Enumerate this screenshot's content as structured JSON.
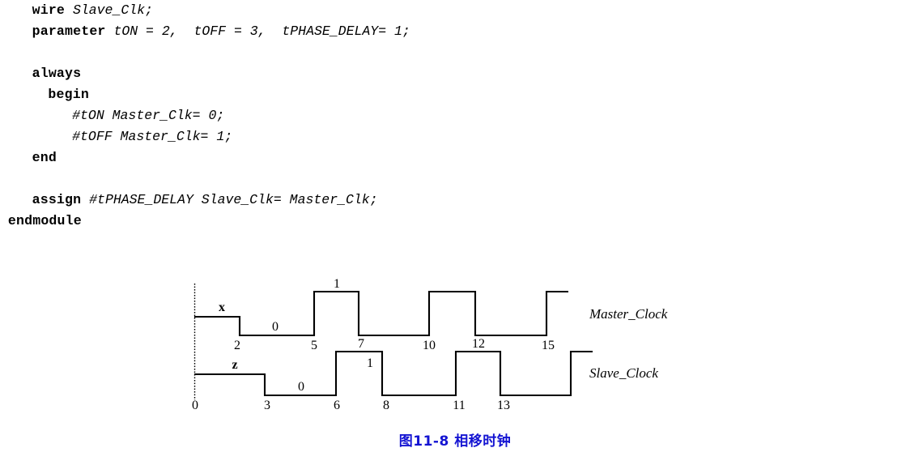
{
  "code": {
    "language": "verilog",
    "lines": [
      {
        "indent": 4,
        "tokens": [
          {
            "text": "wire",
            "style": "keyword"
          },
          {
            "text": " ",
            "style": "plain"
          },
          {
            "text": "Slave_Clk;",
            "style": "identifier"
          }
        ]
      },
      {
        "indent": 4,
        "tokens": [
          {
            "text": "parameter",
            "style": "keyword"
          },
          {
            "text": " ",
            "style": "plain"
          },
          {
            "text": "tON = 2,  tOFF = 3,  tPHASE_DELAY= 1;",
            "style": "identifier"
          }
        ]
      },
      {
        "indent": 0,
        "tokens": []
      },
      {
        "indent": 4,
        "tokens": [
          {
            "text": "always",
            "style": "keyword"
          }
        ]
      },
      {
        "indent": 6,
        "tokens": [
          {
            "text": "begin",
            "style": "keyword"
          }
        ]
      },
      {
        "indent": 9,
        "tokens": [
          {
            "text": "#tON Master_Clk= 0;",
            "style": "identifier"
          }
        ]
      },
      {
        "indent": 9,
        "tokens": [
          {
            "text": "#tOFF Master_Clk= 1;",
            "style": "identifier"
          }
        ]
      },
      {
        "indent": 4,
        "tokens": [
          {
            "text": "end",
            "style": "keyword"
          }
        ]
      },
      {
        "indent": 0,
        "tokens": []
      },
      {
        "indent": 4,
        "tokens": [
          {
            "text": "assign",
            "style": "keyword"
          },
          {
            "text": " ",
            "style": "plain"
          },
          {
            "text": "#tPHASE_DELAY Slave_Clk= Master_Clk;",
            "style": "identifier"
          }
        ]
      },
      {
        "indent": 1,
        "tokens": [
          {
            "text": "endmodule",
            "style": "keyword"
          }
        ]
      }
    ]
  },
  "figure": {
    "caption": "图11-8  相移时钟",
    "caption_color": "#1414d2",
    "signals": [
      {
        "name": "Master_Clock",
        "state_label": "x",
        "low_label": "0",
        "high_label": "1"
      },
      {
        "name": "Slave_Clock",
        "state_label": "z",
        "low_label": "0",
        "high_label": "1"
      }
    ],
    "master_time_labels": [
      "2",
      "5",
      "7",
      "10",
      "12",
      "15"
    ],
    "slave_time_labels": [
      "0",
      "3",
      "6",
      "8",
      "11",
      "13"
    ]
  },
  "chart_data": {
    "type": "line",
    "title": "图11-8  相移时钟",
    "xlabel": "",
    "ylabel": "",
    "grid": false,
    "legend_position": "right",
    "xlim": [
      0,
      17
    ],
    "series": [
      {
        "name": "Master_Clock",
        "initial_state": "x",
        "transitions": [
          {
            "time": 0,
            "value": "x"
          },
          {
            "time": 2,
            "value": "0"
          },
          {
            "time": 5,
            "value": "1"
          },
          {
            "time": 7,
            "value": "0"
          },
          {
            "time": 10,
            "value": "1"
          },
          {
            "time": 12,
            "value": "0"
          },
          {
            "time": 15,
            "value": "1"
          }
        ],
        "tick_times": [
          2,
          5,
          7,
          10,
          12,
          15
        ]
      },
      {
        "name": "Slave_Clock",
        "initial_state": "z",
        "transitions": [
          {
            "time": 0,
            "value": "z"
          },
          {
            "time": 3,
            "value": "0"
          },
          {
            "time": 6,
            "value": "1"
          },
          {
            "time": 8,
            "value": "0"
          },
          {
            "time": 11,
            "value": "1"
          },
          {
            "time": 13,
            "value": "0"
          },
          {
            "time": 16,
            "value": "1"
          }
        ],
        "tick_times": [
          0,
          3,
          6,
          8,
          11,
          13
        ]
      }
    ]
  }
}
